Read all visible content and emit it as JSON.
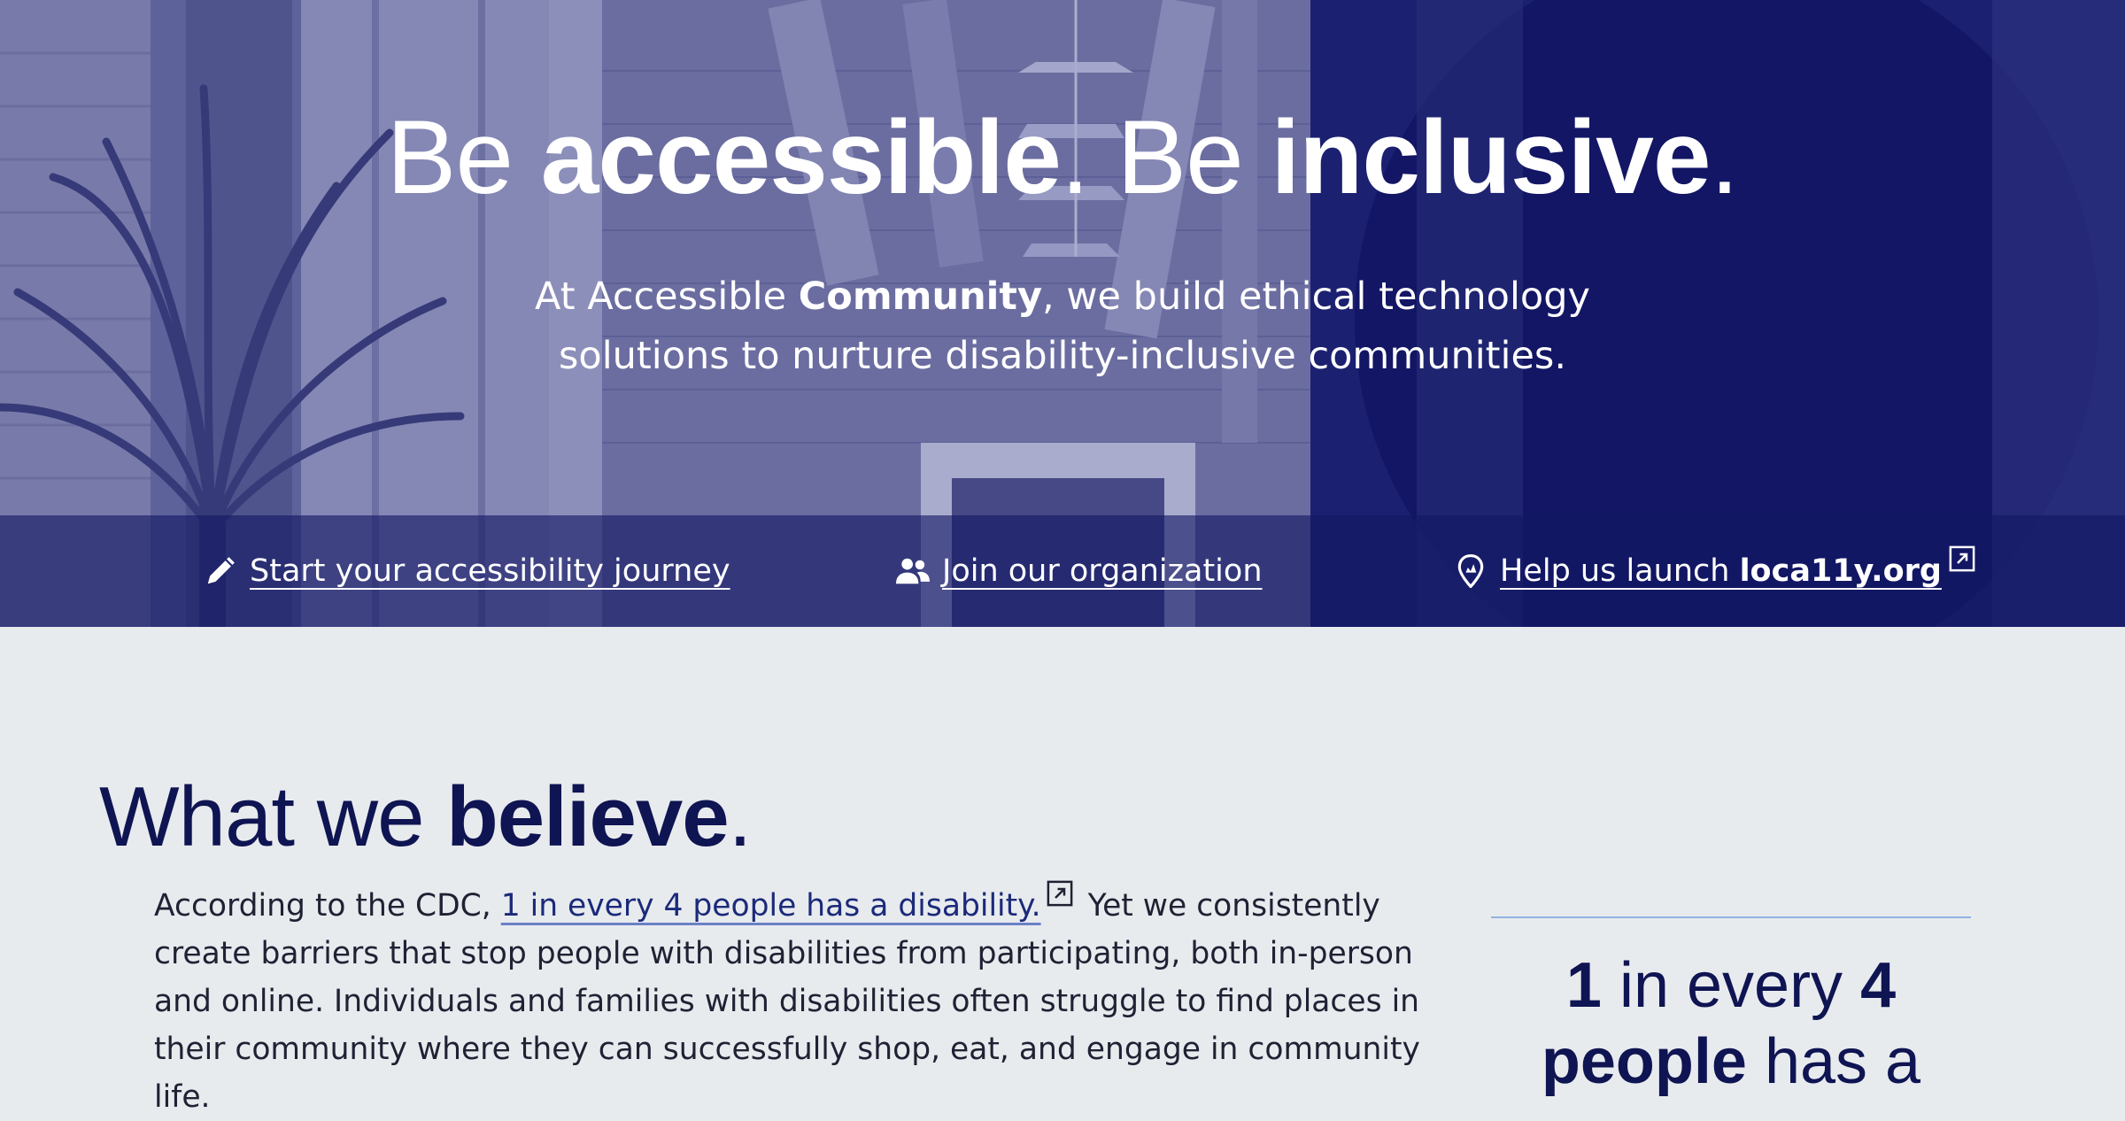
{
  "hero": {
    "title_part1": "Be ",
    "title_bold1": "accessible",
    "title_part2": ". Be ",
    "title_bold2": "inclusive",
    "title_part3": ".",
    "subtitle_part1": "At Accessible ",
    "subtitle_bold": "Community",
    "subtitle_part2": ", we build ethical technology solutions to nurture disability-inclusive communities."
  },
  "actions": {
    "journey": {
      "label": "Start your accessibility journey",
      "icon": "pencil-icon"
    },
    "join": {
      "label": "Join our organization",
      "icon": "people-icon"
    },
    "launch": {
      "label_prefix": "Help us launch ",
      "label_bold": "loca11y.org",
      "icon": "map-pin-icon",
      "external_icon": "external-link-icon"
    }
  },
  "believe": {
    "title_part1": "What we ",
    "title_bold": "believe",
    "title_part2": ".",
    "text_part1": "According to the CDC, ",
    "link_text": "1 in every 4 people has a disability.",
    "text_part2": " Yet we consistently create barriers that stop people with disabilities from participating, both in-person and online. Individuals and families with disabilities often struggle to find places in their community where they can successfully shop, eat, and engage in community life."
  },
  "stat": {
    "num1": "1",
    "text1": " in every ",
    "num2": "4",
    "bold2": "people",
    "text2": " has a"
  },
  "colors": {
    "navy": "#0f1452",
    "hero_overlay": "#5b5e95",
    "page_bg": "#e8ebee",
    "link": "#1b2a7a",
    "divider": "#8fb3e0"
  }
}
